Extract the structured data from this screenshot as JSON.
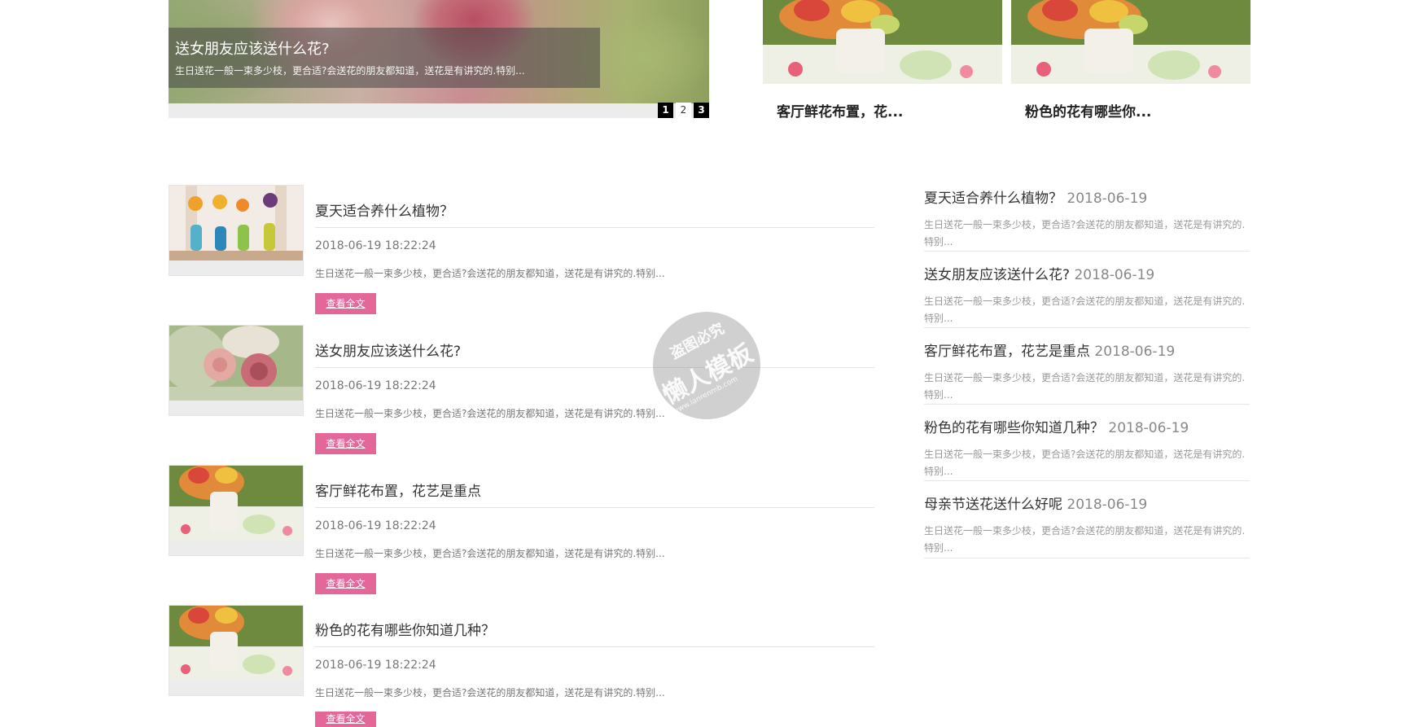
{
  "slider": {
    "title": "送女朋友应该送什么花?",
    "desc": "生日送花一般一束多少枝，更合适?会送花的朋友都知道，送花是有讲究的.特别...",
    "pages": [
      "1",
      "2",
      "3"
    ]
  },
  "featured": [
    {
      "title": "客厅鲜花布置，花..."
    },
    {
      "title": "粉色的花有哪些你..."
    }
  ],
  "articles": [
    {
      "title": "夏天适合养什么植物？",
      "date": "2018-06-19 18:22:24",
      "desc": "生日送花一般一束多少枝，更合适?会送花的朋友都知道，送花是有讲究的.特别...",
      "more": "查看全文"
    },
    {
      "title": "送女朋友应该送什么花?",
      "date": "2018-06-19 18:22:24",
      "desc": "生日送花一般一束多少枝，更合适?会送花的朋友都知道，送花是有讲究的.特别...",
      "more": "查看全文"
    },
    {
      "title": "客厅鲜花布置，花艺是重点",
      "date": "2018-06-19 18:22:24",
      "desc": "生日送花一般一束多少枝，更合适?会送花的朋友都知道，送花是有讲究的.特别...",
      "more": "查看全文"
    },
    {
      "title": "粉色的花有哪些你知道几种？",
      "date": "2018-06-19 18:22:24",
      "desc": "生日送花一般一束多少枝，更合适?会送花的朋友都知道，送花是有讲究的.特别...",
      "more": "查看全文"
    }
  ],
  "sidebar": [
    {
      "title": "夏天适合养什么植物？",
      "date": "2018-06-19",
      "desc": "生日送花一般一束多少枝，更合适?会送花的朋友都知道，送花是有讲究的.特别..."
    },
    {
      "title": "送女朋友应该送什么花?",
      "date": "2018-06-19",
      "desc": "生日送花一般一束多少枝，更合适?会送花的朋友都知道，送花是有讲究的.特别..."
    },
    {
      "title": "客厅鲜花布置，花艺是重点",
      "date": "2018-06-19",
      "desc": "生日送花一般一束多少枝，更合适?会送花的朋友都知道，送花是有讲究的.特别..."
    },
    {
      "title": "粉色的花有哪些你知道几种？",
      "date": "2018-06-19",
      "desc": "生日送花一般一束多少枝，更合适?会送花的朋友都知道，送花是有讲究的.特别..."
    },
    {
      "title": "母亲节送花送什么好呢",
      "date": "2018-06-19",
      "desc": "生日送花一般一束多少枝，更合适?会送花的朋友都知道，送花是有讲究的.特别..."
    }
  ],
  "watermark": {
    "line1": "盗图必究",
    "line2": "懒人模板",
    "line3": "www.lanrenmb.com"
  },
  "colors": {
    "accent": "#e4679a",
    "active_dot": "#000000"
  }
}
